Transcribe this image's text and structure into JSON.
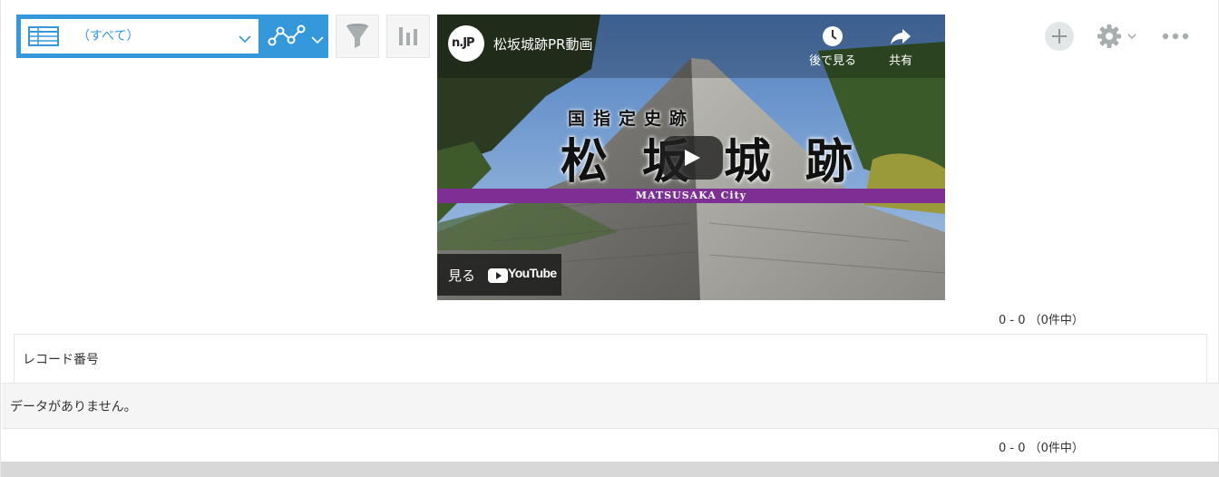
{
  "view_selector": {
    "view_label": "（すべて）",
    "icons": [
      "table-icon",
      "chevron-down-icon",
      "graph-icon",
      "chevron-down-icon"
    ]
  },
  "toolbar": {
    "filter_icon": "filter-icon",
    "chart_icon": "bar-chart-icon",
    "add_icon": "plus-icon",
    "settings_icon": "gear-icon",
    "more_icon": "more-dots-icon"
  },
  "video": {
    "channel_badge": "n.JP",
    "title": "松坂城跡PR動画",
    "watch_later_label": "後で見る",
    "share_label": "共有",
    "overlay_small": "国指定史跡",
    "overlay_big": "松坂城跡",
    "band_text": "MATSUSAKA City",
    "watch_label": "見る",
    "youtube_label": "YouTube"
  },
  "pager_top": {
    "range": "0 - 0",
    "total": "（0件中）"
  },
  "table": {
    "columns": [
      "レコード番号"
    ],
    "empty_message": "データがありません。"
  },
  "pager_bottom": {
    "range": "0 - 0",
    "total": "（0件中）"
  },
  "colors": {
    "accent": "#3498db",
    "band_purple": "#7e2f94",
    "border": "#e3e7e8",
    "row_bg": "#f5f5f5"
  }
}
